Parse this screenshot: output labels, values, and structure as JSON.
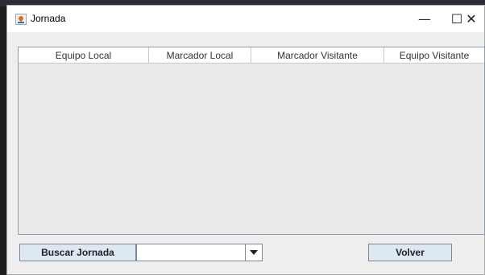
{
  "window": {
    "title": "Jornada",
    "icon": "java-cup-icon",
    "controls": {
      "minimize": "—",
      "maximize": "☐",
      "close": "✕"
    }
  },
  "table": {
    "columns": [
      "Equipo Local",
      "Marcador Local",
      "Marcador Visitante",
      "Equipo Visitante"
    ],
    "rows": []
  },
  "footer": {
    "search_button": "Buscar Jornada",
    "jornada_select": {
      "value": "",
      "options": []
    },
    "back_button": "Volver"
  }
}
